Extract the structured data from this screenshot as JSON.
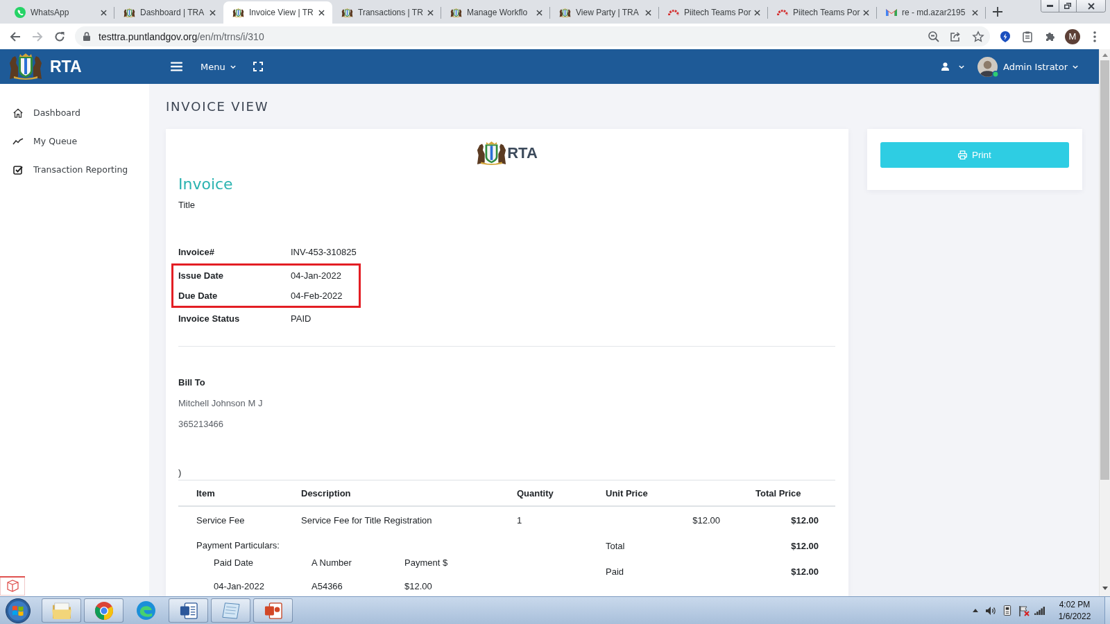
{
  "browser": {
    "tabs": [
      {
        "title": "WhatsApp",
        "selected": false
      },
      {
        "title": "Dashboard | TRA",
        "selected": false
      },
      {
        "title": "Invoice View | TR",
        "selected": true
      },
      {
        "title": "Transactions | TR",
        "selected": false
      },
      {
        "title": "Manage Workflo",
        "selected": false
      },
      {
        "title": "View Party | TRA",
        "selected": false
      },
      {
        "title": "Piitech Teams Por",
        "selected": false
      },
      {
        "title": "Piitech Teams Por",
        "selected": false
      },
      {
        "title": "re - md.azar2195",
        "selected": false
      }
    ],
    "forward_disabled": true,
    "address": "testtra.puntlandgov.org/en/m/trns/i/310",
    "profile_initial": "M"
  },
  "app_header": {
    "brand": "RTA",
    "menu_label": "Menu",
    "user": {
      "name": "Admin Istrator",
      "online": true
    }
  },
  "sidebar": {
    "items": [
      {
        "label": "Dashboard"
      },
      {
        "label": "My Queue"
      },
      {
        "label": "Transaction Reporting"
      }
    ]
  },
  "page_title": "INVOICE VIEW",
  "invoice": {
    "brand": "RTA",
    "heading": "Invoice",
    "subtitle": "Title",
    "fields": [
      {
        "label": "Invoice#",
        "value": "INV-453-310825",
        "highlighted": false
      },
      {
        "label": "Issue Date",
        "value": "04-Jan-2022",
        "highlighted": true
      },
      {
        "label": "Due Date",
        "value": "04-Feb-2022",
        "highlighted": true
      },
      {
        "label": "Invoice Status",
        "value": "PAID",
        "highlighted": false
      }
    ],
    "bill_to": {
      "heading": "Bill To",
      "lines": [
        "Mitchell Johnson M J",
        "365213466"
      ]
    },
    "note": ")",
    "table": {
      "columns": [
        "Item",
        "Description",
        "Quantity",
        "Unit Price",
        "Total Price"
      ],
      "rows": [
        [
          "Service Fee",
          "Service Fee for Title Registration",
          "1",
          "$12.00",
          "$12.00"
        ]
      ]
    },
    "payment_particulars": {
      "heading": "Payment Particulars:",
      "columns": [
        "Paid Date",
        "A Number",
        "Payment $"
      ],
      "rows": [
        [
          "04-Jan-2022",
          "A54366",
          "$12.00"
        ]
      ]
    },
    "totals": [
      {
        "label": "Total",
        "value": "$12.00"
      },
      {
        "label": "Paid",
        "value": "$12.00"
      }
    ]
  },
  "print_button": {
    "label": "Print"
  },
  "taskbar": {
    "time": "4:02 PM",
    "date": "1/6/2022"
  }
}
